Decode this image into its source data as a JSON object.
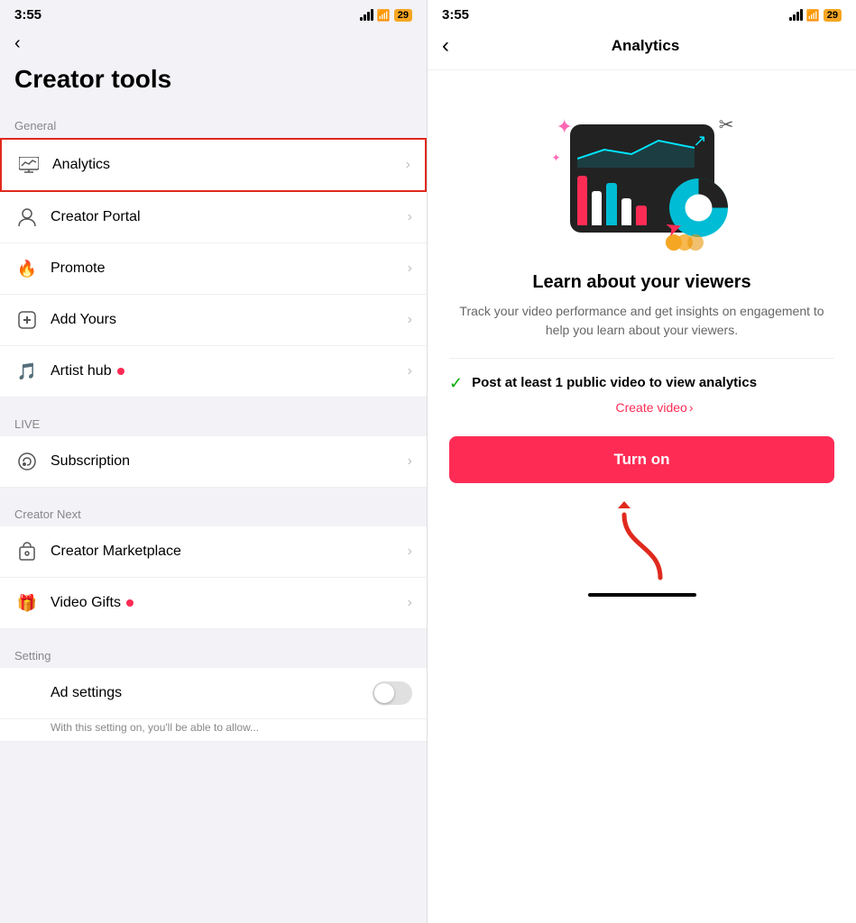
{
  "app": {
    "time": "3:55",
    "battery": "29"
  },
  "left": {
    "back_label": "‹",
    "page_title": "Creator tools",
    "sections": [
      {
        "label": "General",
        "items": [
          {
            "id": "analytics",
            "label": "Analytics",
            "icon": "📈",
            "highlighted": true,
            "new_dot": false
          },
          {
            "id": "creator-portal",
            "label": "Creator Portal",
            "icon": "👤",
            "highlighted": false,
            "new_dot": false
          },
          {
            "id": "promote",
            "label": "Promote",
            "icon": "🔥",
            "highlighted": false,
            "new_dot": false
          },
          {
            "id": "add-yours",
            "label": "Add Yours",
            "icon": "➕",
            "highlighted": false,
            "new_dot": false
          },
          {
            "id": "artist-hub",
            "label": "Artist hub",
            "icon": "🎵",
            "highlighted": false,
            "new_dot": true
          }
        ]
      },
      {
        "label": "LIVE",
        "items": [
          {
            "id": "subscription",
            "label": "Subscription",
            "icon": "🐾",
            "highlighted": false,
            "new_dot": false
          }
        ]
      },
      {
        "label": "Creator Next",
        "items": [
          {
            "id": "creator-marketplace",
            "label": "Creator Marketplace",
            "icon": "🔒",
            "highlighted": false,
            "new_dot": false
          },
          {
            "id": "video-gifts",
            "label": "Video Gifts",
            "icon": "🎁",
            "highlighted": false,
            "new_dot": true
          }
        ]
      },
      {
        "label": "Setting",
        "items": [
          {
            "id": "ad-settings",
            "label": "Ad settings",
            "icon": "",
            "highlighted": false,
            "new_dot": false,
            "toggle": true
          }
        ]
      }
    ],
    "ad_settings_desc": "With this setting on, you'll be able to allow..."
  },
  "right": {
    "back_label": "‹",
    "title": "Analytics",
    "illustration_alt": "Analytics chart illustration",
    "section_title": "Learn about your viewers",
    "section_desc": "Track your video performance and get insights on engagement to help you learn about your viewers.",
    "requirement": "Post at least 1 public video to view analytics",
    "create_video_label": "Create video",
    "create_video_chevron": "›",
    "turn_on_label": "Turn on"
  }
}
